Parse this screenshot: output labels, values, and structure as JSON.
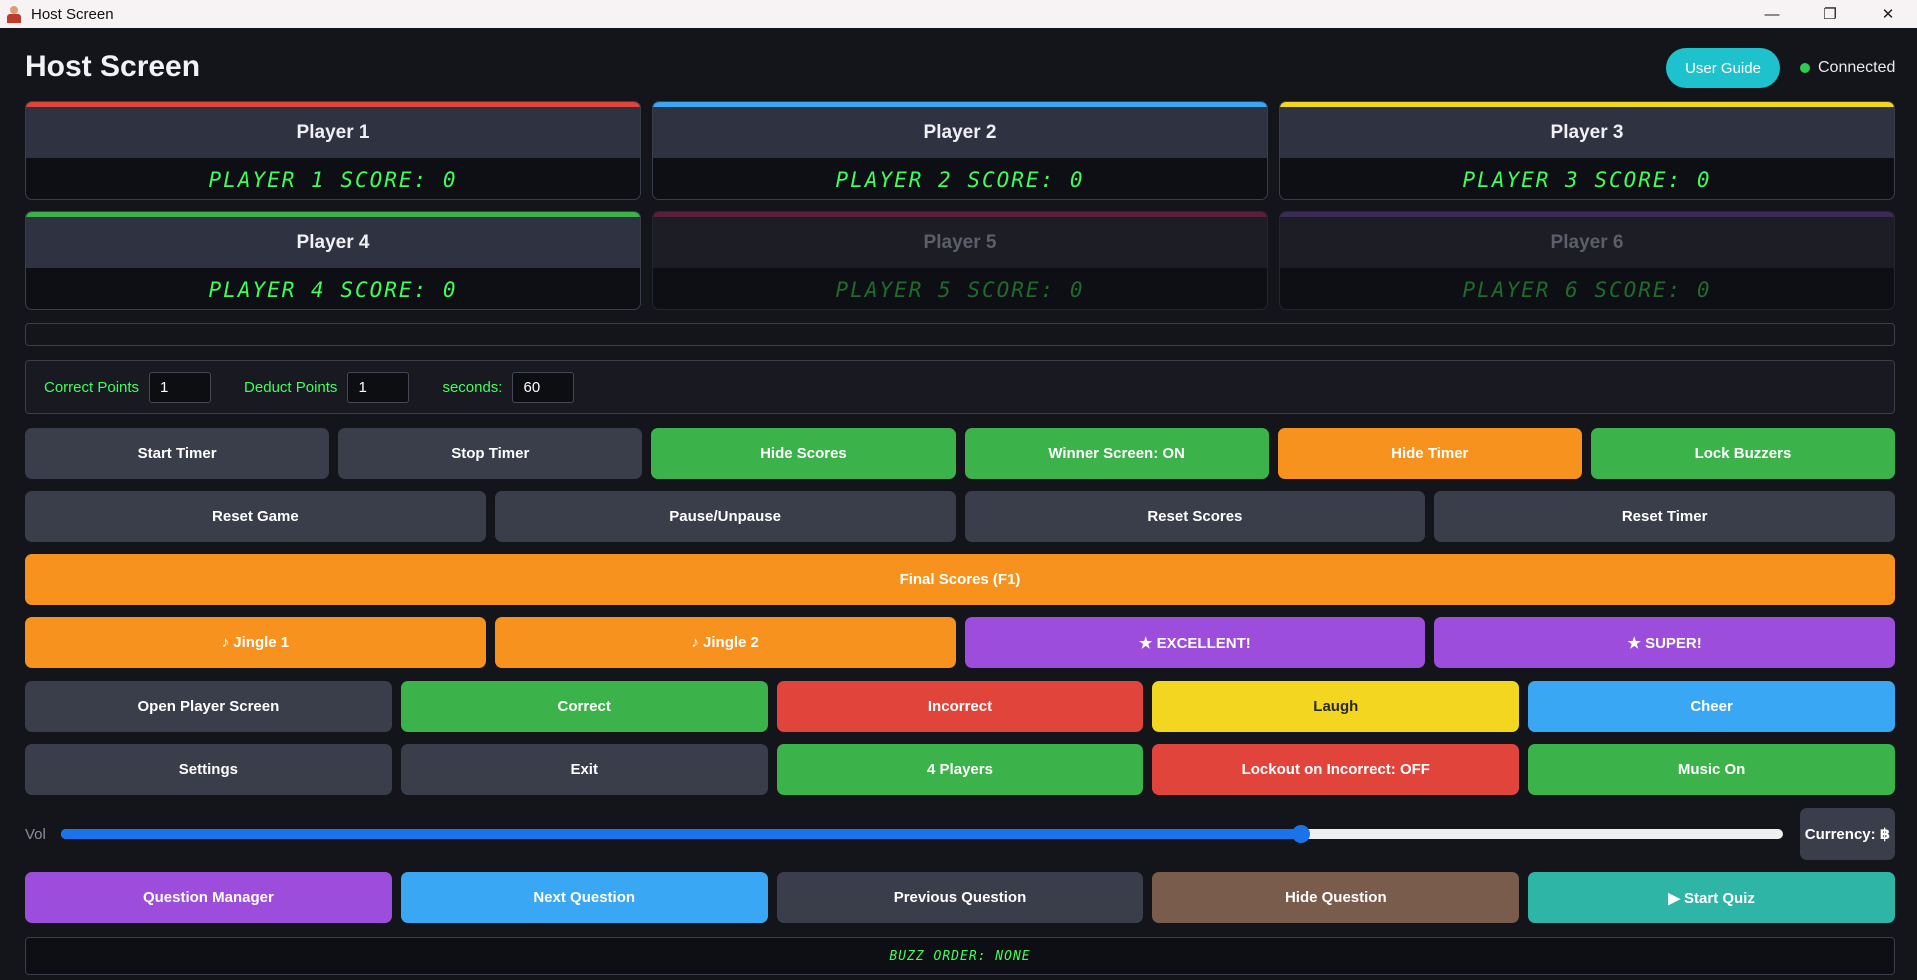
{
  "window": {
    "title": "Host Screen",
    "controls": [
      "—",
      "❐",
      "✕"
    ]
  },
  "header": {
    "title": "Host Screen",
    "user_guide": "User Guide",
    "status": "Connected",
    "status_color": "#2ecc51"
  },
  "players": [
    {
      "name": "Player 1",
      "score": "PLAYER 1 SCORE: 0",
      "color": "#e0443a",
      "active": true
    },
    {
      "name": "Player 2",
      "score": "PLAYER 2 SCORE: 0",
      "color": "#3aa7f5",
      "active": true
    },
    {
      "name": "Player 3",
      "score": "PLAYER 3 SCORE: 0",
      "color": "#f2d61f",
      "active": true
    },
    {
      "name": "Player 4",
      "score": "PLAYER 4 SCORE: 0",
      "color": "#3bb34a",
      "active": true
    },
    {
      "name": "Player 5",
      "score": "PLAYER 5 SCORE: 0",
      "color": "#5a1f3a",
      "active": false
    },
    {
      "name": "Player 6",
      "score": "PLAYER 6 SCORE: 0",
      "color": "#3a2a55",
      "active": false
    }
  ],
  "settings": {
    "correct_label": "Correct Points",
    "correct_value": "1",
    "deduct_label": "Deduct Points",
    "deduct_value": "1",
    "seconds_label": "seconds:",
    "seconds_value": "60"
  },
  "row1": [
    "Start Timer",
    "Stop Timer",
    "Hide Scores",
    "Winner Screen: ON",
    "Hide Timer",
    "Lock Buzzers"
  ],
  "row2": [
    "Reset Game",
    "Pause/Unpause",
    "Reset Scores",
    "Reset Timer"
  ],
  "final_scores": "Final Scores (F1)",
  "row4": [
    "♪ Jingle 1",
    "♪ Jingle 2",
    "★ EXCELLENT!",
    "★ SUPER!"
  ],
  "row5": [
    "Open Player Screen",
    "Correct",
    "Incorrect",
    "Laugh",
    "Cheer"
  ],
  "row6": [
    "Settings",
    "Exit",
    "4 Players",
    "Lockout on Incorrect: OFF",
    "Music On"
  ],
  "volume": {
    "label": "Vol",
    "level": 0.72,
    "currency": "Currency: ฿"
  },
  "row8": [
    "Question Manager",
    "Next Question",
    "Previous Question",
    "Hide Question",
    "▶ Start Quiz"
  ],
  "buzz_order": "BUZZ ORDER: NONE"
}
